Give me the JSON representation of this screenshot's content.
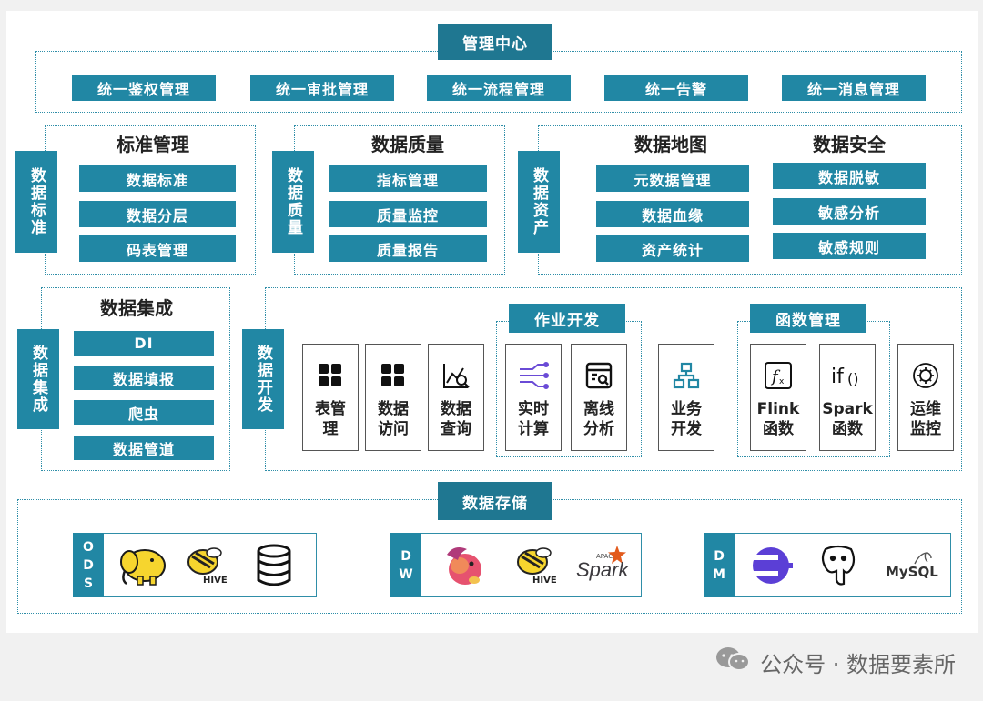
{
  "management_center": {
    "title": "管理中心",
    "items": [
      "统一鉴权管理",
      "统一审批管理",
      "统一流程管理",
      "统一告警",
      "统一消息管理"
    ]
  },
  "data_standard": {
    "side_label": "数据标准",
    "title": "标准管理",
    "items": [
      "数据标准",
      "数据分层",
      "码表管理"
    ]
  },
  "data_quality": {
    "side_label": "数据质量",
    "title": "数据质量",
    "items": [
      "指标管理",
      "质量监控",
      "质量报告"
    ]
  },
  "data_asset": {
    "side_label": "数据资产",
    "map_title": "数据地图",
    "map_items": [
      "元数据管理",
      "数据血缘",
      "资产统计"
    ],
    "security_title": "数据安全",
    "security_items": [
      "数据脱敏",
      "敏感分析",
      "敏感规则"
    ]
  },
  "data_integration": {
    "side_label": "数据集成",
    "title": "数据集成",
    "items": [
      "DI",
      "数据填报",
      "爬虫",
      "数据管道"
    ]
  },
  "data_dev": {
    "side_label": "数据开发",
    "job_dev_title": "作业开发",
    "func_mgmt_title": "函数管理",
    "cards": {
      "table_mgmt": "表管\n理",
      "data_access": "数据\n访问",
      "data_query": "数据\n查询",
      "realtime": "实时\n计算",
      "offline": "离线\n分析",
      "business": "业务\n开发",
      "flink": "Flink\n函数",
      "spark": "Spark\n函数",
      "ops": "运维\n监控"
    }
  },
  "data_storage": {
    "title": "数据存储",
    "ods_label": [
      "O",
      "D",
      "S"
    ],
    "dw_label": [
      "D",
      "W"
    ],
    "dm_label": [
      "D",
      "M"
    ],
    "logos": {
      "hive": "HIVE",
      "spark_apache": "APACHE",
      "spark": "Spark",
      "mysql": "MySQL"
    }
  },
  "footer": {
    "text": "公众号 · 数据要素所"
  },
  "colors": {
    "teal": "#2187a4",
    "border": "#2f8ea8",
    "background": "#f1f1f1"
  }
}
